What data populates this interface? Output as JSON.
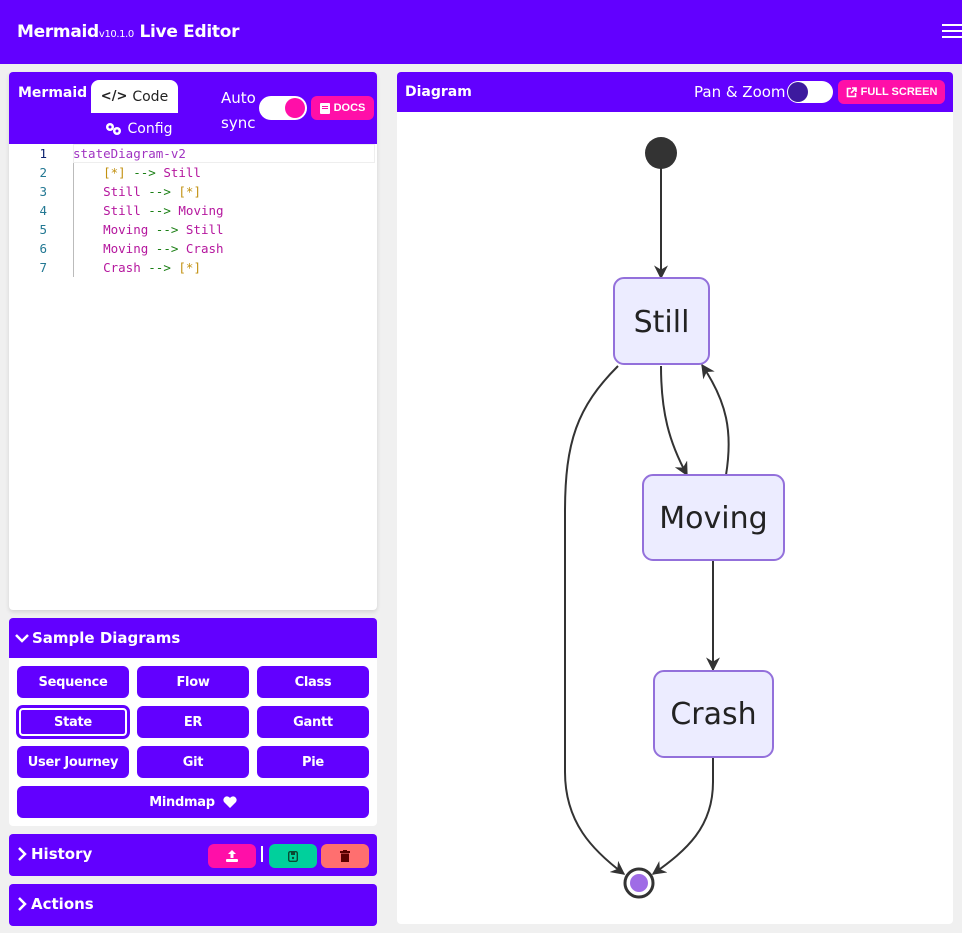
{
  "navbar": {
    "brand": "Mermaid",
    "version": "v10.1.0",
    "title": "Live Editor",
    "menu_icon": "hamburger-icon"
  },
  "editor": {
    "title": "Mermaid",
    "tabs": [
      {
        "label": "Code",
        "icon": "code-icon",
        "active": true
      },
      {
        "label": "Config",
        "icon": "gears-icon",
        "active": false
      }
    ],
    "autosync_label_1": "Auto",
    "autosync_label_2": "sync",
    "autosync_on": true,
    "docs_label": "DOCS",
    "code_lines": [
      {
        "num": "1",
        "text": "stateDiagram-v2"
      },
      {
        "num": "2",
        "text": "    [*] --> Still"
      },
      {
        "num": "3",
        "text": "    Still --> [*]"
      },
      {
        "num": "4",
        "text": "    Still --> Moving"
      },
      {
        "num": "5",
        "text": "    Moving --> Still"
      },
      {
        "num": "6",
        "text": "    Moving --> Crash"
      },
      {
        "num": "7",
        "text": "    Crash --> [*]"
      }
    ]
  },
  "samples": {
    "title": "Sample Diagrams",
    "buttons": [
      "Sequence",
      "Flow",
      "Class",
      "State",
      "ER",
      "Gantt",
      "User Journey",
      "Git",
      "Pie"
    ],
    "active": "State",
    "mindmap_label": "Mindmap"
  },
  "history": {
    "title": "History",
    "buttons": [
      {
        "name": "upload",
        "color": "#ff0fa8"
      },
      {
        "name": "save",
        "color": "#00d09c"
      },
      {
        "name": "delete",
        "color": "#ff6f6f"
      }
    ]
  },
  "actions": {
    "title": "Actions"
  },
  "diagram": {
    "title": "Diagram",
    "panzoom_label": "Pan & Zoom",
    "panzoom_on": false,
    "fullscreen_label": "FULL SCREEN",
    "nodes": [
      {
        "id": "Still",
        "label": "Still"
      },
      {
        "id": "Moving",
        "label": "Moving"
      },
      {
        "id": "Crash",
        "label": "Crash"
      }
    ],
    "transitions": [
      {
        "from": "[*]",
        "to": "Still"
      },
      {
        "from": "Still",
        "to": "[*]"
      },
      {
        "from": "Still",
        "to": "Moving"
      },
      {
        "from": "Moving",
        "to": "Still"
      },
      {
        "from": "Moving",
        "to": "Crash"
      },
      {
        "from": "Crash",
        "to": "[*]"
      }
    ]
  },
  "colors": {
    "primary": "#6200ff",
    "accent": "#ff0fa8",
    "node_fill": "#ececff",
    "node_stroke": "#9370db"
  }
}
